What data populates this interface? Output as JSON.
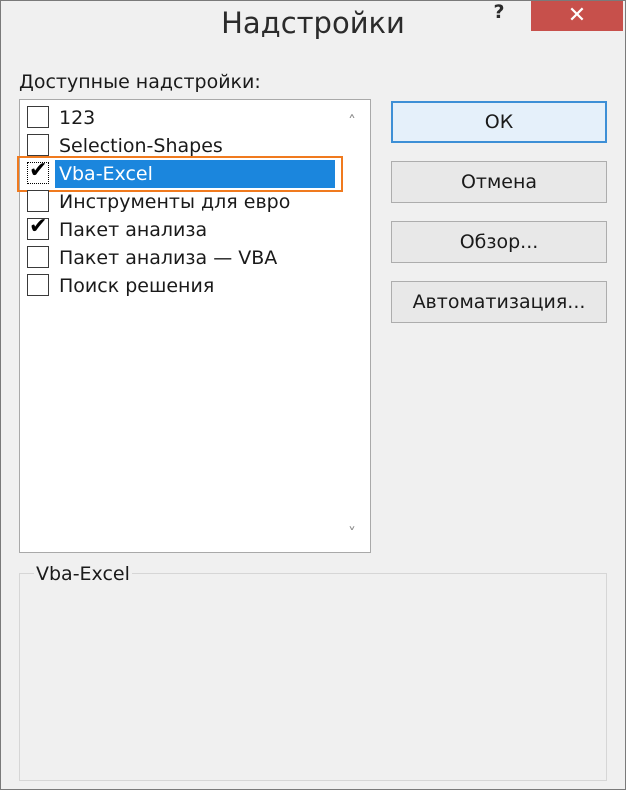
{
  "window": {
    "title": "Надстройки",
    "help_label": "?",
    "close_label": "✕"
  },
  "list": {
    "label": "Доступные надстройки:",
    "items": [
      {
        "label": "123",
        "checked": false,
        "selected": false
      },
      {
        "label": "Selection-Shapes",
        "checked": false,
        "selected": false
      },
      {
        "label": "Vba-Excel",
        "checked": true,
        "selected": true
      },
      {
        "label": "Инструменты для евро",
        "checked": false,
        "selected": false
      },
      {
        "label": "Пакет анализа",
        "checked": true,
        "selected": false
      },
      {
        "label": "Пакет анализа — VBA",
        "checked": false,
        "selected": false
      },
      {
        "label": "Поиск решения",
        "checked": false,
        "selected": false
      }
    ],
    "scroll_up": "˄",
    "scroll_down": "˅"
  },
  "buttons": {
    "ok": "ОК",
    "cancel": "Отмена",
    "browse": "Обзор...",
    "automation": "Автоматизация..."
  },
  "description": {
    "title": "Vba-Excel"
  },
  "colors": {
    "selection": "#1b86dd",
    "focus_outline": "#f07a1e",
    "close_button": "#c7504b"
  },
  "check_glyph": "✔"
}
